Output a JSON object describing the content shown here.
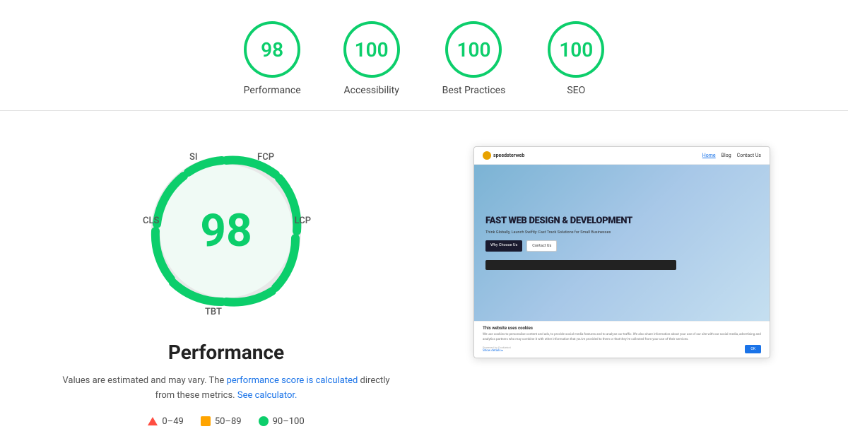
{
  "scores": [
    {
      "id": "performance",
      "value": "98",
      "label": "Performance"
    },
    {
      "id": "accessibility",
      "value": "100",
      "label": "Accessibility"
    },
    {
      "id": "best-practices",
      "value": "100",
      "label": "Best Practices"
    },
    {
      "id": "seo",
      "value": "100",
      "label": "SEO"
    }
  ],
  "radial": {
    "score": "98",
    "labels": {
      "si": "SI",
      "fcp": "FCP",
      "lcp": "LCP",
      "tbt": "TBT",
      "cls": "CLS"
    }
  },
  "perf_title": "Performance",
  "footer_note_1": "Values are estimated and may vary. The ",
  "footer_link_1": "performance score is calculated",
  "footer_note_2": " directly from these metrics. ",
  "footer_link_2": "See calculator.",
  "legend": [
    {
      "id": "red",
      "range": "0–49"
    },
    {
      "id": "orange",
      "range": "50–89"
    },
    {
      "id": "green",
      "range": "90–100"
    }
  ],
  "preview": {
    "logo": "speedsterweb",
    "nav_links": [
      "Home",
      "Blog",
      "Contact Us"
    ],
    "hero_title": "FAST WEB DESIGN & DEVELOPMENT",
    "hero_sub": "Think Globally, Launch Swiftly: Fast Track Solutions for Small Businesses",
    "btn1": "Why Choose Us",
    "btn2": "Contact Us",
    "cookie_title": "This website uses cookies",
    "cookie_text": "We use cookies to personalise content and ads, to provide social media features and to analyse our traffic. We also share information about your use of our site with our social media, advertising and analytics partners who may combine it with other information that you've provided to them or that they've collected from your use of their services.",
    "cookie_btn": "OK",
    "powered_by": "Powered by Cookiebot",
    "show_details": "Show details ▸"
  }
}
